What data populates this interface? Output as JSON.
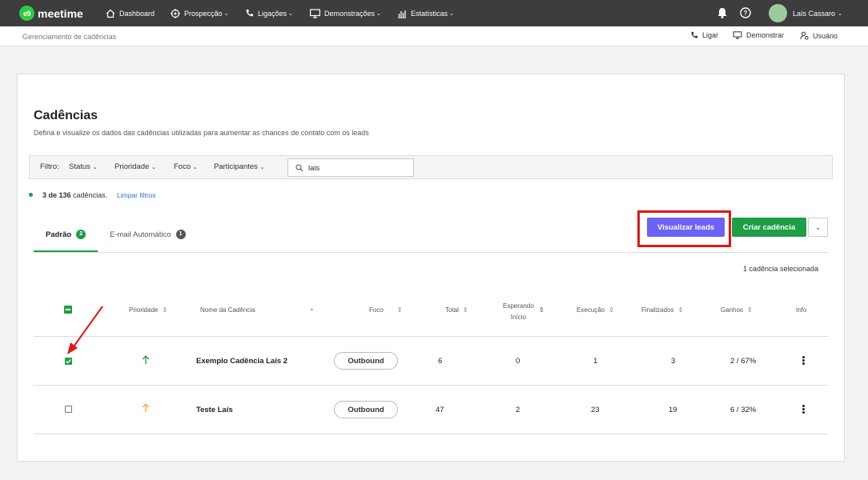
{
  "topbar": {
    "logo_mark": "e9",
    "logo_text": "meetime",
    "nav": [
      "Dashboard",
      "Prospecção",
      "Ligações",
      "Demonstrações",
      "Estatísticas"
    ],
    "user_name": "Laís Cassaro",
    "brand_color": "#2ecc40"
  },
  "subbar": {
    "breadcrumb": "Gerenciamento de cadências",
    "actions": [
      "Ligar",
      "Demonstrar",
      "Usuário"
    ]
  },
  "page": {
    "title": "Cadências",
    "subtitle": "Defina e visualize os dados das cadências utilizadas para aumentar as chances de contato com os leads"
  },
  "filter": {
    "label": "Filtro:",
    "items": [
      "Status",
      "Prioridade",
      "Foco",
      "Participantes"
    ],
    "search_value": "lais"
  },
  "summary": {
    "count": "3 de 136",
    "count_suffix": "cadências.",
    "clear_label": "Limpar filtros"
  },
  "tabs": [
    {
      "label": "Padrão",
      "badge": "2",
      "active": true
    },
    {
      "label": "E-mail Automático",
      "badge": "1",
      "active": false
    }
  ],
  "buttons": {
    "visualize": "Visualizar leads",
    "create": "Criar cadência",
    "visualize_color": "#6b63f6",
    "create_color": "#1e9e47"
  },
  "selected_info": "1 cadência selecionada",
  "table": {
    "headers": {
      "priority": "Prioridade",
      "name": "Nome da Cadência",
      "focus": "Foco",
      "total": "Total",
      "waiting_line1": "Esperando",
      "waiting_line2": "Início",
      "execution": "Execução",
      "finished": "Finalizados",
      "won": "Ganhos",
      "info": "Info"
    },
    "rows": [
      {
        "checked": true,
        "priority_color": "#1e9e47",
        "name": "Exemplo Cadência Laís 2",
        "focus": "Outbound",
        "total": "6",
        "waiting": "0",
        "execution": "1",
        "finished": "3",
        "won": "2 / 67%"
      },
      {
        "checked": false,
        "priority_color": "#f5a623",
        "name": "Teste Laís",
        "focus": "Outbound",
        "total": "47",
        "waiting": "2",
        "execution": "23",
        "finished": "19",
        "won": "6 / 32%"
      }
    ]
  },
  "annotation_color": "#e01616"
}
